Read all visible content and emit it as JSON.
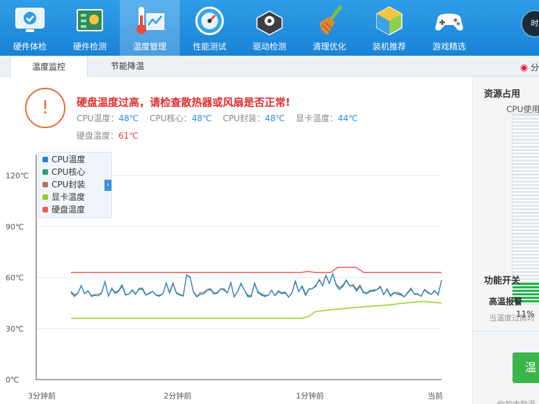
{
  "nav": {
    "items": [
      {
        "label": "硬件体检",
        "icon": "monitor-check-icon"
      },
      {
        "label": "硬件检测",
        "icon": "circuit-board-icon"
      },
      {
        "label": "温度管理",
        "icon": "thermometer-chart-icon",
        "active": true
      },
      {
        "label": "性能测试",
        "icon": "speedometer-icon"
      },
      {
        "label": "驱动检测",
        "icon": "gear-box-icon"
      },
      {
        "label": "清理优化",
        "icon": "broom-icon"
      },
      {
        "label": "装机推荐",
        "icon": "cube-icon"
      },
      {
        "label": "游戏精选",
        "icon": "gamepad-icon"
      }
    ],
    "badge_label": "时"
  },
  "subtabs": {
    "items": [
      {
        "label": "温度监控",
        "active": true
      },
      {
        "label": "节能降温",
        "active": false
      }
    ],
    "share_label": "分"
  },
  "alert": {
    "icon_symbol": "!",
    "title": "硬盘温度过高，请检查散热器或风扇是否正常!",
    "readings": [
      {
        "label": "CPU温度：",
        "value": "48℃"
      },
      {
        "label": "CPU核心：",
        "value": "48℃"
      },
      {
        "label": "CPU封装：",
        "value": "48℃"
      },
      {
        "label": "显卡温度：",
        "value": "44℃"
      }
    ],
    "disk_label": "硬盘温度：",
    "disk_value": "61℃"
  },
  "chart_data": {
    "type": "line",
    "x_ticks": [
      "3分钟前",
      "2分钟前",
      "1分钟前",
      "当前"
    ],
    "y_ticks": [
      "0℃",
      "30℃",
      "60℃",
      "90℃",
      "120℃"
    ],
    "ylim": [
      0,
      120
    ],
    "grid": true,
    "legend_position": "top-left",
    "series": [
      {
        "name": "CPU温度",
        "color": "#2d7fd8"
      },
      {
        "name": "CPU核心",
        "color": "#29a374"
      },
      {
        "name": "CPU封装",
        "color": "#b07a5a"
      },
      {
        "name": "显卡温度",
        "color": "#9acd22"
      },
      {
        "name": "硬盘温度",
        "color": "#ee5a5a"
      }
    ],
    "curves": {
      "disk": [
        [
          0,
          63
        ],
        [
          0.62,
          63
        ],
        [
          0.64,
          63.6
        ],
        [
          0.66,
          63
        ],
        [
          0.7,
          63
        ],
        [
          0.72,
          66
        ],
        [
          0.77,
          66
        ],
        [
          0.79,
          63
        ],
        [
          1,
          63
        ]
      ],
      "gpu": [
        [
          0,
          36
        ],
        [
          0.62,
          36
        ],
        [
          0.64,
          37
        ],
        [
          0.66,
          40
        ],
        [
          0.7,
          41
        ],
        [
          0.75,
          42
        ],
        [
          0.8,
          43
        ],
        [
          0.86,
          44
        ],
        [
          0.9,
          45
        ],
        [
          0.95,
          46
        ],
        [
          1,
          45
        ]
      ],
      "cpu_base": 51,
      "cpu_points": 110
    }
  },
  "resources": {
    "title": "资源占用",
    "cpu_label": "CPU使用",
    "cpu_usage": 0.11,
    "cpu_pct_text": "11%"
  },
  "features": {
    "title": "功能开关",
    "alarm_title": "高温报警",
    "alarm_desc": "当温度过高时",
    "button_label": "温",
    "footer": "你的电脑温"
  }
}
